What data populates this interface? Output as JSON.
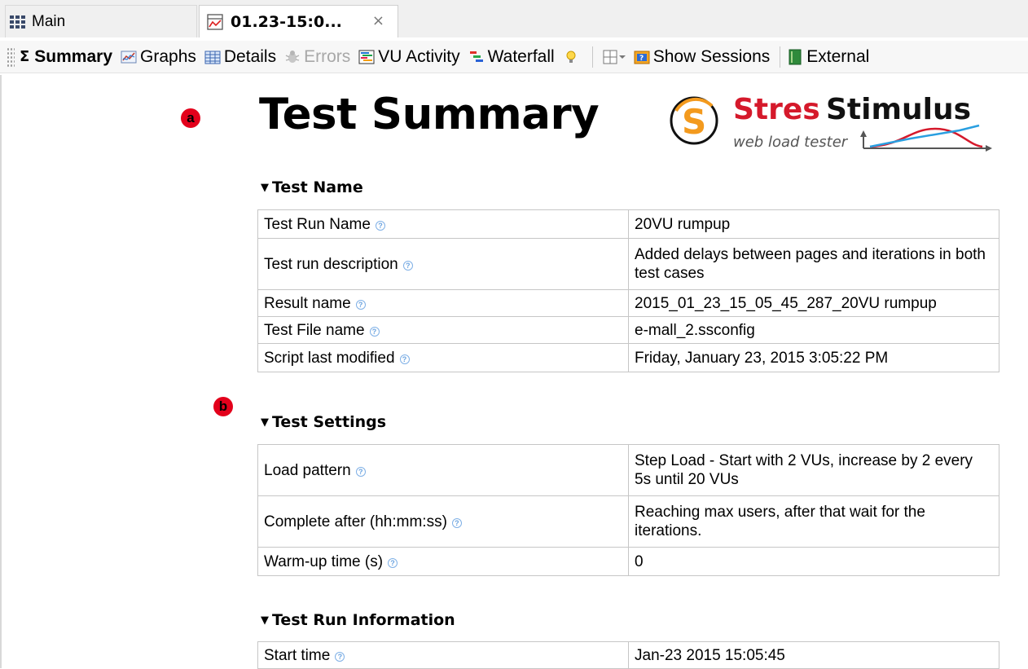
{
  "tabs": [
    {
      "label": "Main"
    },
    {
      "label": "01.23-15:0...",
      "close": "×"
    }
  ],
  "toolbar": {
    "items": [
      {
        "label": "Summary",
        "icon": "sigma-icon"
      },
      {
        "label": "Graphs",
        "icon": "graph-icon"
      },
      {
        "label": "Details",
        "icon": "table-icon"
      },
      {
        "label": "Errors",
        "icon": "bug-icon"
      },
      {
        "label": "VU Activity",
        "icon": "vu-activity-icon"
      },
      {
        "label": "Waterfall",
        "icon": "waterfall-icon"
      },
      {
        "label": "Show Sessions",
        "icon": "sessions-icon"
      },
      {
        "label": "External",
        "icon": "book-icon"
      }
    ]
  },
  "markers": {
    "a": "a",
    "b": "b"
  },
  "page": {
    "title": "Test Summary",
    "logo": {
      "name_red": "Stres",
      "name_black": "Stimulus",
      "tagline": "web load tester"
    }
  },
  "sections": {
    "test_name": {
      "heading": "Test Name",
      "rows": [
        {
          "key": "Test Run Name",
          "value": "20VU rumpup"
        },
        {
          "key": "Test run description",
          "value": "Added delays between pages and iterations in both test cases"
        },
        {
          "key": "Result name",
          "value": "2015_01_23_15_05_45_287_20VU rumpup"
        },
        {
          "key": "Test File name",
          "value": "e-mall_2.ssconfig"
        },
        {
          "key": "Script last modified",
          "value": "Friday, January 23, 2015 3:05:22 PM"
        }
      ]
    },
    "test_settings": {
      "heading": "Test Settings",
      "rows": [
        {
          "key": "Load pattern",
          "value": "Step Load - Start with 2 VUs, increase by 2 every 5s until 20 VUs"
        },
        {
          "key": "Complete after (hh:mm:ss)",
          "value": "Reaching max users, after that wait for the iterations."
        },
        {
          "key": "Warm-up time (s)",
          "value": "0"
        }
      ]
    },
    "test_run_info": {
      "heading": "Test Run Information",
      "rows": [
        {
          "key": "Start time",
          "value": "Jan-23 2015 15:05:45"
        }
      ]
    }
  },
  "colors": {
    "brand_red": "#d5192b",
    "marker_red": "#e3001b",
    "logo_orange": "#f39a1e"
  }
}
